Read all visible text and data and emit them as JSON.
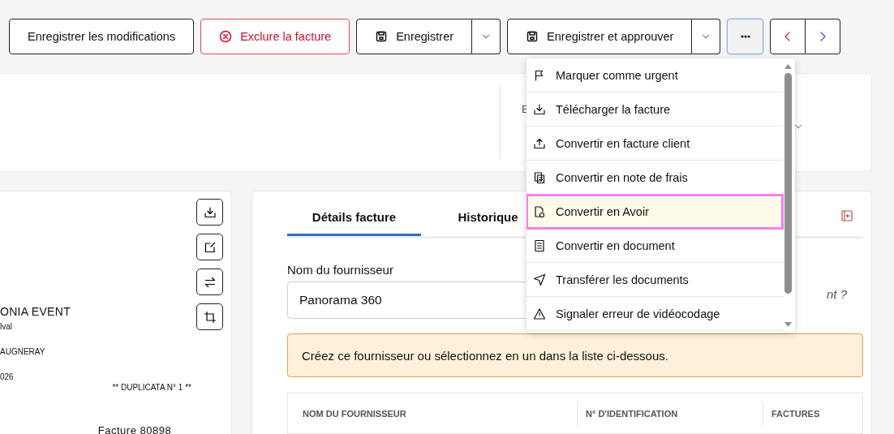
{
  "toolbar": {
    "buttons": [
      {
        "kind": "plain",
        "label": "Enregistrer les modifications"
      },
      {
        "kind": "danger",
        "label": "Exclure la facture"
      },
      {
        "kind": "split",
        "label": "Enregistrer"
      },
      {
        "kind": "split",
        "label": "Enregistrer et approuver"
      },
      {
        "kind": "more",
        "expanded": true
      },
      {
        "kind": "pager"
      }
    ]
  },
  "header_card": {
    "field": {
      "label": "E"
    }
  },
  "document_preview": {
    "lines": [
      {
        "kind": "name",
        "text": "ONIA EVENT"
      },
      {
        "kind": "small",
        "text": "lval"
      },
      {
        "kind": "small",
        "text": "AUGNERAY"
      },
      {
        "kind": "small",
        "text": "026"
      },
      {
        "kind": "note",
        "text": "** DUPLICATA N° 1 **"
      },
      {
        "kind": "title",
        "text": "Facture 80898"
      }
    ]
  },
  "details_panel": {
    "tabs": [
      {
        "label": "Détails facture",
        "selected": true
      },
      {
        "label": "Historique",
        "selected": false
      }
    ],
    "supplier_field": {
      "label": "Nom du fournisseur",
      "value": "Panorama 360"
    },
    "link_fragment": "nt ?",
    "alert": "Créez ce fournisseur ou sélectionnez en un dans la liste ci-dessous.",
    "table": {
      "columns": [
        "NOM DU FOURNISSEUR",
        "N° D'IDENTIFICATION",
        "FACTURES"
      ]
    }
  },
  "menu": {
    "items": [
      {
        "label": "Marquer comme urgent",
        "selected": false
      },
      {
        "label": "Télécharger la facture",
        "selected": false
      },
      {
        "label": "Convertir en facture client",
        "selected": false
      },
      {
        "label": "Convertir en note de frais",
        "selected": false
      },
      {
        "label": "Convertir en Avoir",
        "selected": true
      },
      {
        "label": "Convertir en document",
        "selected": false
      },
      {
        "label": "Transférer les documents",
        "selected": false
      },
      {
        "label": "Signaler erreur de vidéocodage",
        "selected": false
      }
    ]
  }
}
